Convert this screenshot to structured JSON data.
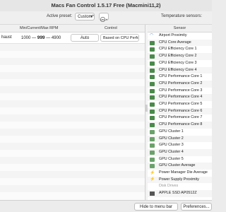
{
  "window": {
    "title": "Macs Fan Control 1.5.17 Free (Macmini11,2)"
  },
  "toolbar": {
    "preset_label": "Active preset:",
    "preset_value": "Custom*",
    "temp_sensors_label": "Temperature sensors:"
  },
  "fans": {
    "headers": {
      "rpm": "Min/Current/Max RPM",
      "control": "Control"
    },
    "rows": [
      {
        "name": "haust",
        "min_rpm": "1000",
        "current_rpm": "999",
        "max_rpm": "4900",
        "mode": "Auto",
        "based_on": "Based on CPU Perfo..."
      }
    ]
  },
  "sensors": {
    "header": "Sensor",
    "items": [
      {
        "label": "Airport Proximity",
        "icon": "wifi-icon"
      },
      {
        "label": "CPU Core Average",
        "icon": "chip-icon"
      },
      {
        "label": "CPU Efficiency Core 1",
        "icon": "chip-icon"
      },
      {
        "label": "CPU Efficiency Core 2",
        "icon": "chip-icon"
      },
      {
        "label": "CPU Efficiency Core 3",
        "icon": "chip-icon"
      },
      {
        "label": "CPU Efficiency Core 4",
        "icon": "chip-icon"
      },
      {
        "label": "CPU Performance Core 1",
        "icon": "chip-icon"
      },
      {
        "label": "CPU Performance Core 2",
        "icon": "chip-icon"
      },
      {
        "label": "CPU Performance Core 3",
        "icon": "chip-icon"
      },
      {
        "label": "CPU Performance Core 4",
        "icon": "chip-icon"
      },
      {
        "label": "CPU Performance Core 5",
        "icon": "chip-icon"
      },
      {
        "label": "CPU Performance Core 6",
        "icon": "chip-icon"
      },
      {
        "label": "CPU Performance Core 7",
        "icon": "chip-icon"
      },
      {
        "label": "CPU Performance Core 8",
        "icon": "chip-icon"
      },
      {
        "label": "GPU Cluster 1",
        "icon": "gpu-icon"
      },
      {
        "label": "GPU Cluster 2",
        "icon": "gpu-icon"
      },
      {
        "label": "GPU Cluster 3",
        "icon": "gpu-icon"
      },
      {
        "label": "GPU Cluster 4",
        "icon": "gpu-icon"
      },
      {
        "label": "GPU Cluster 5",
        "icon": "gpu-icon"
      },
      {
        "label": "GPU Cluster Average",
        "icon": "gpu-icon"
      },
      {
        "label": "Power Manager Die Average",
        "icon": "bolt-icon"
      },
      {
        "label": "Power Supply Proximity",
        "icon": "bolt-icon"
      },
      {
        "label": "Disk Drives",
        "icon": "none",
        "dim": true
      },
      {
        "label": "APPLE SSD AP0512Z",
        "icon": "ssd-icon"
      }
    ]
  },
  "bottom": {
    "hide_label": "Hide to menu bar",
    "prefs_label": "Preferences..."
  },
  "colors": {
    "chip": "#4a8a4a",
    "bolt": "#c0392b",
    "wifi": "#3a7bd5"
  }
}
